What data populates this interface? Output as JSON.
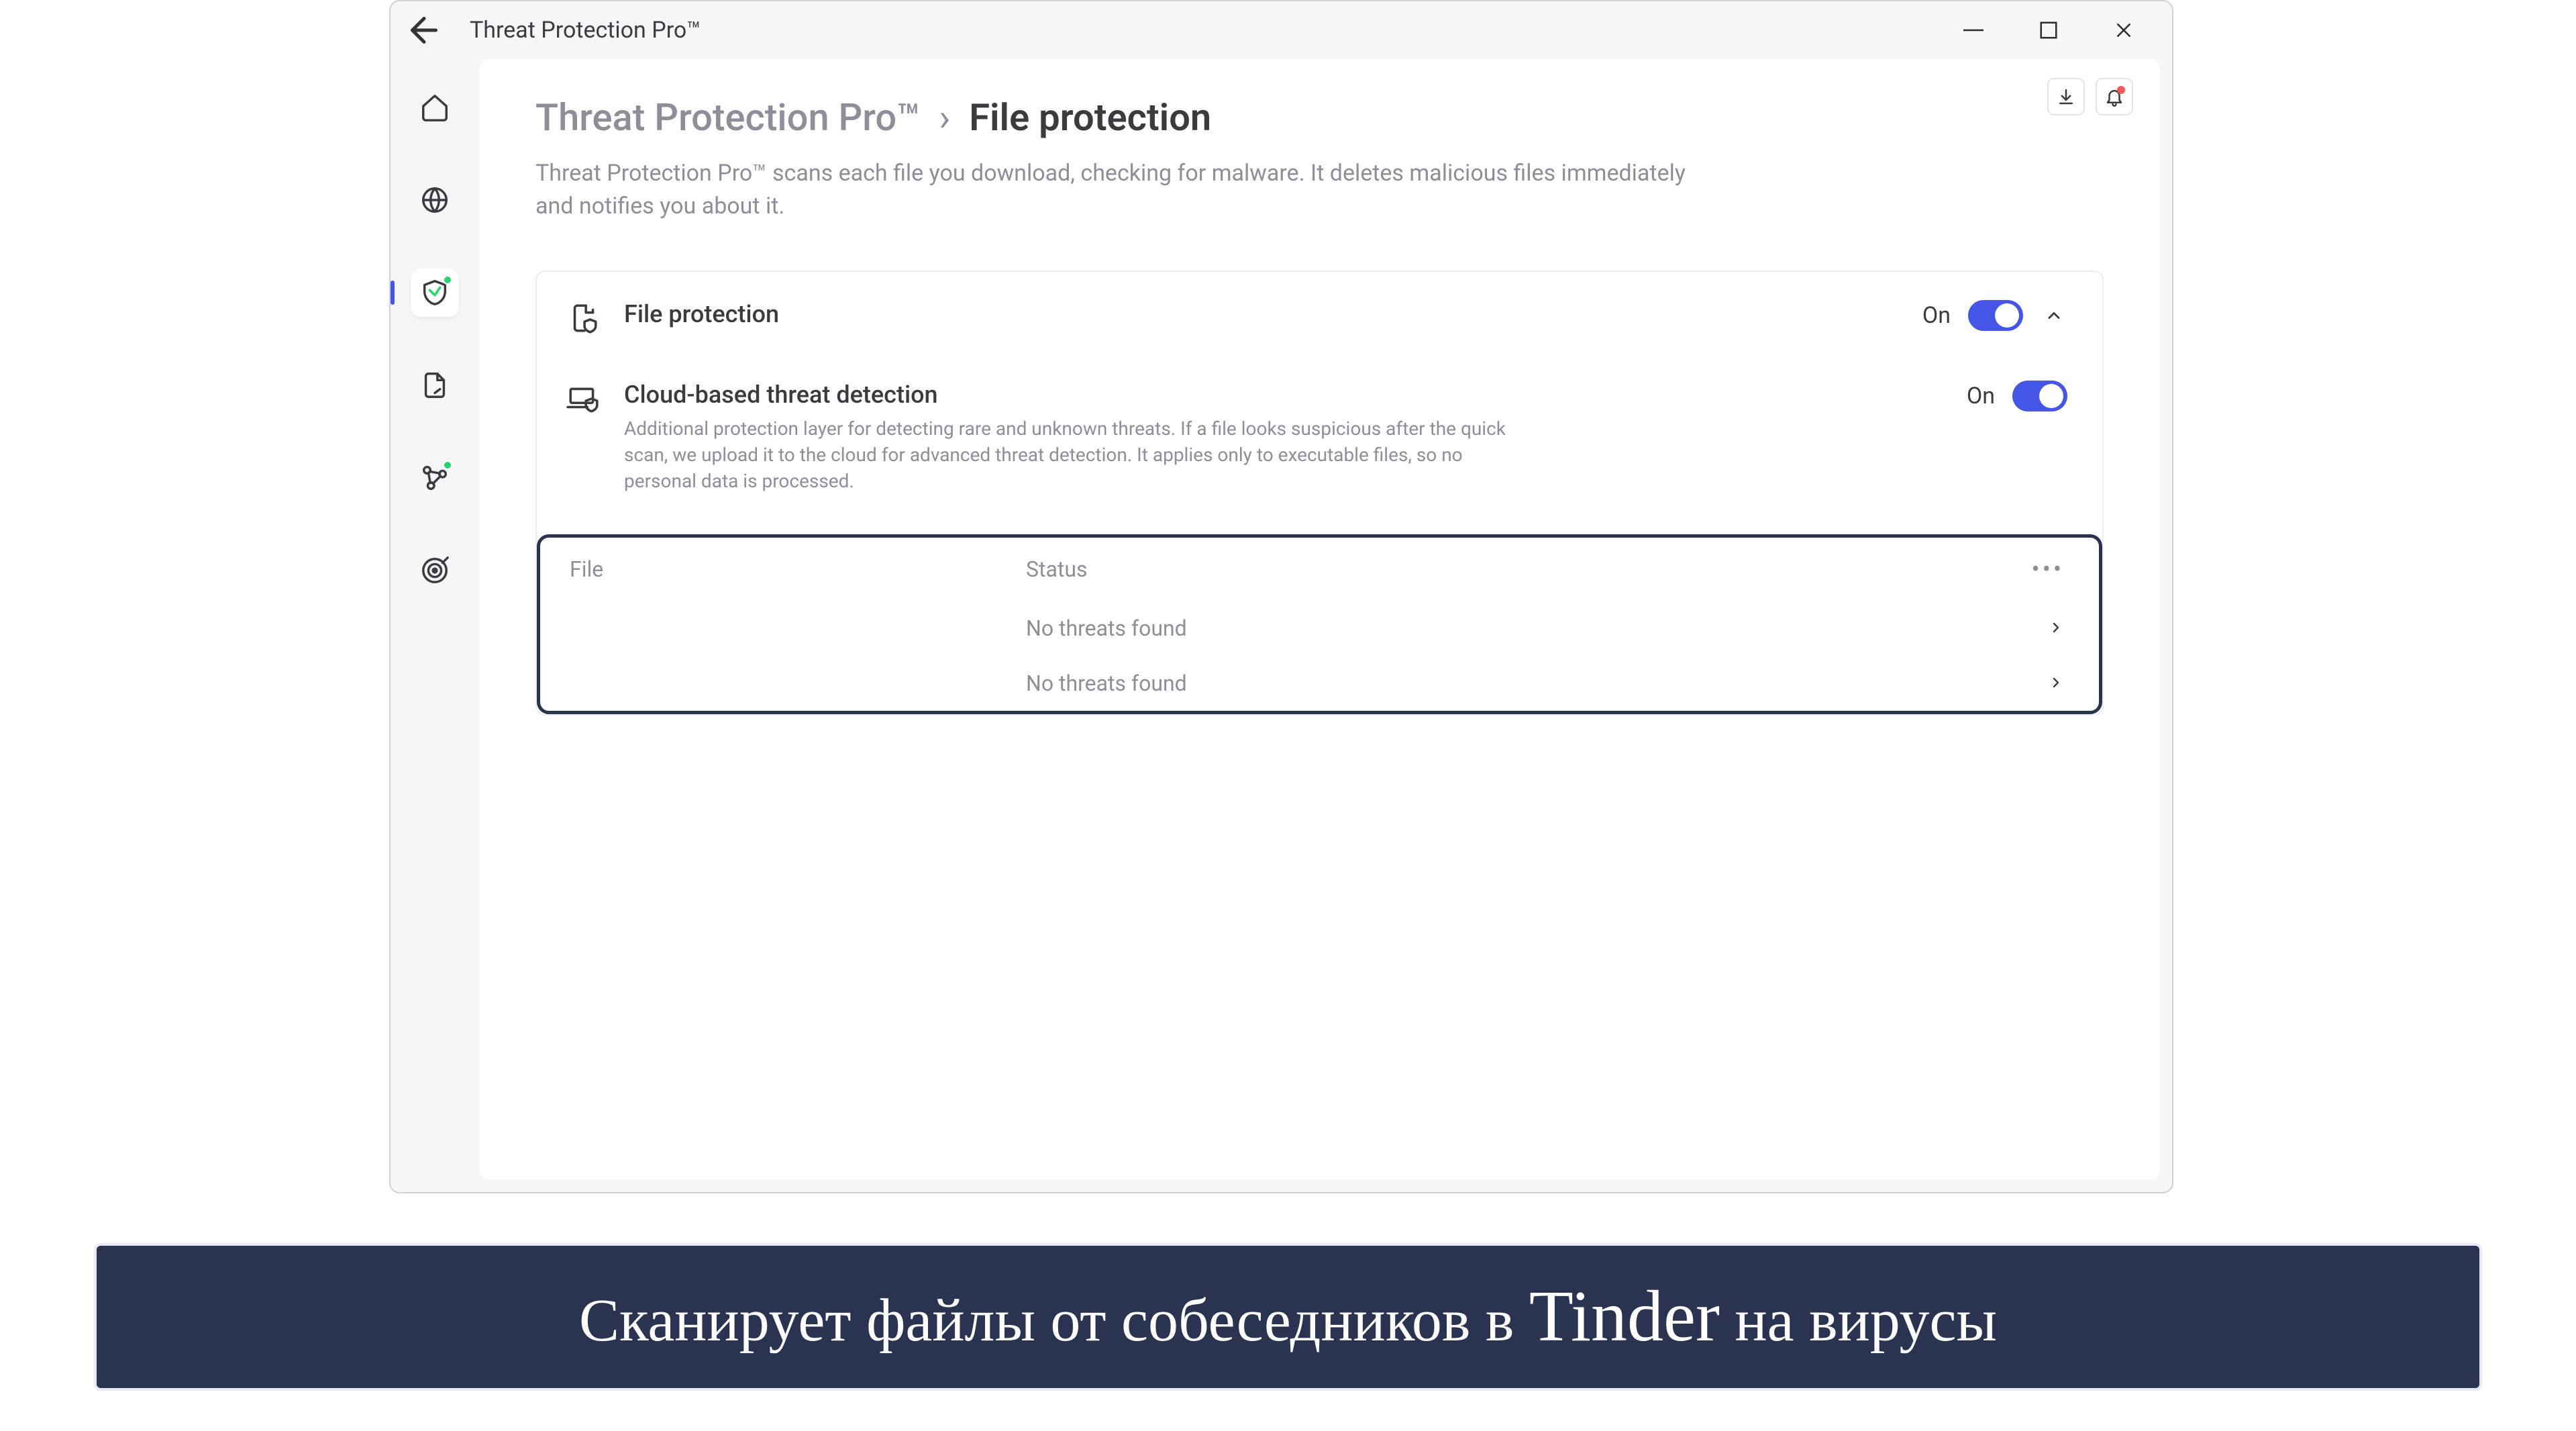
{
  "window": {
    "title": "Threat Protection Pro™"
  },
  "breadcrumb": {
    "root": "Threat Protection Pro™",
    "separator": "›",
    "current": "File protection"
  },
  "page": {
    "description": "Threat Protection Pro™ scans each file you download, checking for malware. It deletes malicious files immediately and notifies you about it."
  },
  "settings": {
    "file_protection": {
      "title": "File protection",
      "state": "On"
    },
    "cloud_detection": {
      "title": "Cloud-based threat detection",
      "description": "Additional protection layer for detecting rare and unknown threats. If a file looks suspicious after the quick scan, we upload it to the cloud for advanced threat detection. It applies only to executable files, so no personal data is processed.",
      "state": "On"
    }
  },
  "file_table": {
    "headers": {
      "file": "File",
      "status": "Status"
    },
    "rows": [
      {
        "file": "",
        "status": "No threats found"
      },
      {
        "file": "",
        "status": "No threats found"
      }
    ]
  },
  "caption": {
    "prefix": "Сканирует файлы от собеседников в ",
    "brand": "Tinder",
    "suffix": " на вирусы"
  }
}
